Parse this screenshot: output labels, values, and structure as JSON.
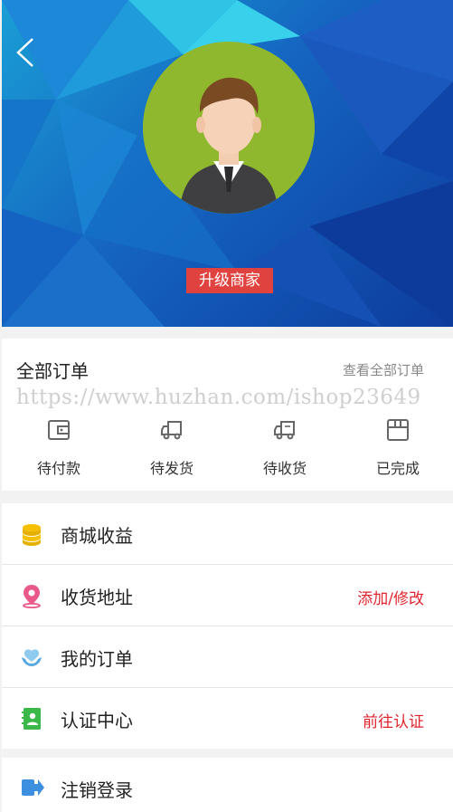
{
  "profile": {
    "upgrade_label": "升级商家"
  },
  "orders": {
    "title": "全部订单",
    "view_all": "查看全部订单",
    "watermark": "https://www.huzhan.com/ishop23649",
    "statuses": [
      {
        "label": "待付款",
        "icon": "wallet-icon"
      },
      {
        "label": "待发货",
        "icon": "truck-icon"
      },
      {
        "label": "待收货",
        "icon": "delivery-truck-icon"
      },
      {
        "label": "已完成",
        "icon": "box-icon"
      }
    ]
  },
  "menu": {
    "items": [
      {
        "label": "商城收益",
        "action": "",
        "icon": "coins-icon",
        "icon_color": "#f5c000"
      },
      {
        "label": "收货地址",
        "action": "添加/修改",
        "icon": "location-pin-icon",
        "icon_color": "#e8598a"
      },
      {
        "label": "我的订单",
        "action": "",
        "icon": "hands-icon",
        "icon_color": "#6ab8e8"
      },
      {
        "label": "认证中心",
        "action": "前往认证",
        "icon": "id-card-icon",
        "icon_color": "#3bb84a"
      }
    ],
    "logout_label": "注销登录",
    "action_color": "#e0252f"
  }
}
